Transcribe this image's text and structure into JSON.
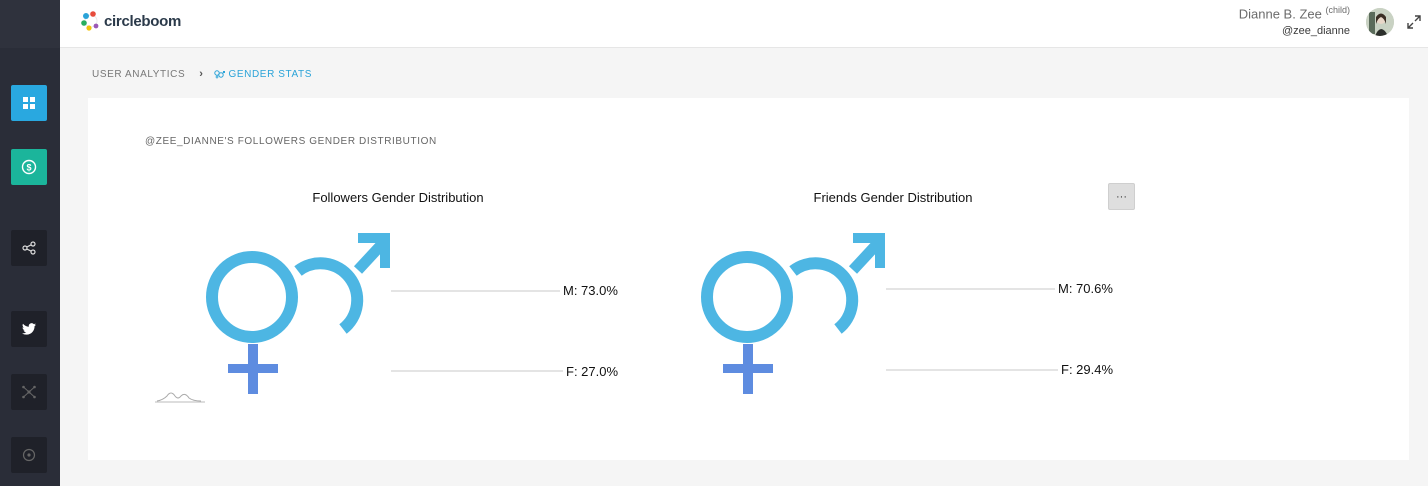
{
  "app": {
    "brand": "circleboom"
  },
  "user": {
    "name": "Dianne B. Zee",
    "tag": "(child)",
    "handle": "@zee_dianne"
  },
  "breadcrumb": {
    "parent": "USER ANALYTICS",
    "current": "GENDER STATS"
  },
  "sidebar": {
    "items": [
      {
        "name": "dashboard",
        "icon": "grid-icon",
        "color": "#29a8e0"
      },
      {
        "name": "billing",
        "icon": "dollar-icon",
        "color": "#1bb59b"
      },
      {
        "name": "share",
        "icon": "share-icon",
        "color": "#1f2129"
      },
      {
        "name": "twitter",
        "icon": "twitter-icon",
        "color": "#1f2129"
      },
      {
        "name": "network",
        "icon": "network-icon",
        "color": "#1f2129"
      },
      {
        "name": "target",
        "icon": "target-icon",
        "color": "#1f2129"
      }
    ]
  },
  "card": {
    "title": "@ZEE_DIANNE'S FOLLOWERS GENDER DISTRIBUTION"
  },
  "charts": [
    {
      "title": "Followers Gender Distribution",
      "male_label": "M: 73.0%",
      "female_label": "F: 27.0%"
    },
    {
      "title": "Friends Gender Distribution",
      "male_label": "M: 70.6%",
      "female_label": "F: 29.4%"
    }
  ],
  "chart_data": [
    {
      "type": "pie",
      "title": "Followers Gender Distribution",
      "categories": [
        "M",
        "F"
      ],
      "values": [
        73.0,
        27.0
      ],
      "colors": [
        "#4db6e3",
        "#5e8ce0"
      ]
    },
    {
      "type": "pie",
      "title": "Friends Gender Distribution",
      "categories": [
        "M",
        "F"
      ],
      "values": [
        70.6,
        29.4
      ],
      "colors": [
        "#4db6e3",
        "#5e8ce0"
      ]
    }
  ],
  "colors": {
    "male": "#4db6e3",
    "female": "#5e8ce0",
    "accent": "#2aa3d8"
  },
  "menu_button": {
    "label": "···"
  }
}
